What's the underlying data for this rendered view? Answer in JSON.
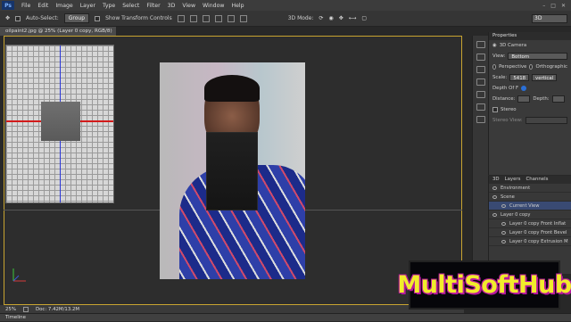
{
  "app": {
    "logo_text": "Ps"
  },
  "menu": [
    "File",
    "Edit",
    "Image",
    "Layer",
    "Type",
    "Select",
    "Filter",
    "3D",
    "View",
    "Window",
    "Help"
  ],
  "options_bar": {
    "auto_select_label": "Auto-Select:",
    "auto_select_value": "Group",
    "transform_label": "Show Transform Controls",
    "mode_label": "3D Mode:"
  },
  "workspace": "3D",
  "document": {
    "tab_title": "oilpaint2.jpg @ 25% (Layer 0 copy, RGB/8) *"
  },
  "properties": {
    "tab": "Properties",
    "title": "3D Camera",
    "view_label": "View:",
    "view_value": "Bottom",
    "perspective_label": "Perspective",
    "ortho_label": "Orthographic",
    "scale_label": "Scale:",
    "scale_value": "5418",
    "vertical_label": "vertical",
    "dof_label": "Depth Of F",
    "distance_label": "Distance:",
    "depth_label": "Depth:",
    "stereo_label": "Stereo",
    "stereo_view_label": "Stereo View:"
  },
  "layers_panel": {
    "tabs": [
      "3D",
      "Layers",
      "Channels"
    ],
    "items": [
      "Environment",
      "Scene",
      "Current View",
      "Layer 0 copy",
      "Layer 0 copy Front Inflat",
      "Layer 0 copy Front Bevel",
      "Layer 0 copy Extrusion M"
    ]
  },
  "status": {
    "zoom": "25%",
    "doc_size": "Doc: 7.42M/13.2M"
  },
  "timeline_label": "Timeline",
  "watermark": "MultiSoftHub",
  "colors": {
    "accent_border": "#c8a430",
    "selection": "#394a73",
    "watermark_text": "#f1ec2b",
    "watermark_outline": "#b8199e"
  }
}
